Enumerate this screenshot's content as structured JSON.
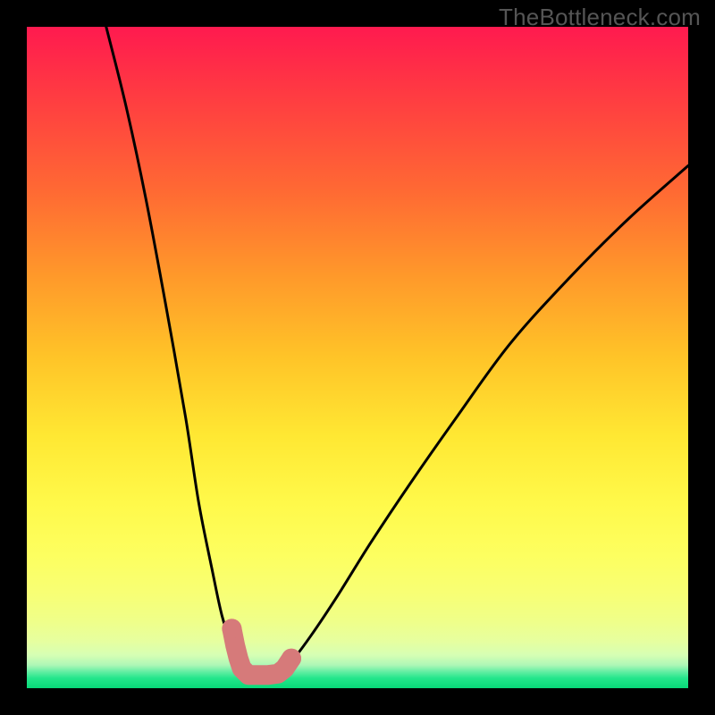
{
  "watermark": "TheBottleneck.com",
  "chart_data": {
    "type": "line",
    "title": "",
    "xlabel": "",
    "ylabel": "",
    "xlim": [
      0,
      100
    ],
    "ylim": [
      0,
      100
    ],
    "series": [
      {
        "name": "left-branch",
        "x": [
          12,
          15,
          18,
          21,
          24,
          26,
          28,
          29.5,
          31,
          32.5,
          34
        ],
        "y": [
          100,
          88,
          74,
          58,
          41,
          28,
          18,
          11,
          6.5,
          3.5,
          2
        ]
      },
      {
        "name": "right-branch",
        "x": [
          38,
          40,
          43,
          47,
          52,
          58,
          65,
          73,
          82,
          91,
          100
        ],
        "y": [
          2,
          4,
          8,
          14,
          22,
          31,
          41,
          52,
          62,
          71,
          79
        ]
      }
    ],
    "highlight": {
      "name": "marker-cluster",
      "color": "#d67a7a",
      "points": [
        {
          "x": 31,
          "y": 9
        },
        {
          "x": 31.5,
          "y": 6.5
        },
        {
          "x": 32,
          "y": 4.5
        },
        {
          "x": 32.5,
          "y": 3
        },
        {
          "x": 33.5,
          "y": 2
        },
        {
          "x": 35,
          "y": 2
        },
        {
          "x": 36.5,
          "y": 2
        },
        {
          "x": 38,
          "y": 2.2
        },
        {
          "x": 39,
          "y": 3
        },
        {
          "x": 40,
          "y": 4.5
        }
      ]
    },
    "minimum_x": 36
  }
}
